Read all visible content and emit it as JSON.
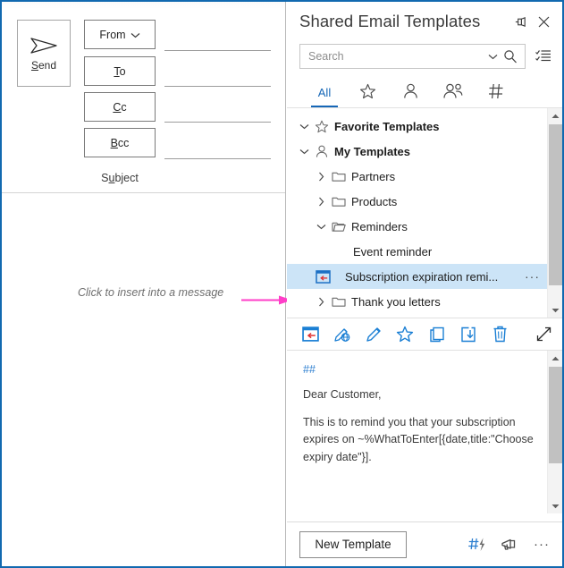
{
  "colors": {
    "window_border": "#1169b0",
    "accent_blue": "#1667b7",
    "icon_blue": "#1b7fd4",
    "selection_bg": "#cce4f7",
    "annotation_arrow": "#ff3ec8",
    "hash_blue": "#2d7fd0",
    "insert_icon_arrow": "#e03030"
  },
  "compose": {
    "send_button": {
      "label": "Send",
      "accel": "S",
      "icon": "send-arrow-icon"
    },
    "fields": [
      {
        "label": "From",
        "accel": "",
        "icon": "chevron-down-icon",
        "name": "from"
      },
      {
        "label": "To",
        "accel": "T",
        "icon": "",
        "name": "to"
      },
      {
        "label": "Cc",
        "accel": "C",
        "icon": "",
        "name": "cc"
      },
      {
        "label": "Bcc",
        "accel": "B",
        "icon": "",
        "name": "bcc"
      }
    ],
    "subject_label": "Subject",
    "subject_accel": "u",
    "annotation": "Click to insert into a message"
  },
  "panel": {
    "title": "Shared Email Templates",
    "header_icons": [
      {
        "name": "pin-icon",
        "glyph": "pin"
      },
      {
        "name": "close-icon",
        "glyph": "close"
      }
    ],
    "search": {
      "placeholder": "Search",
      "value": "",
      "dropdown_icon": "chevron-down-icon",
      "search_icon": "search-icon",
      "checklist_icon": "checklist-icon"
    },
    "tabs": [
      {
        "label": "All",
        "icon": "",
        "name": "tab-all",
        "active": true
      },
      {
        "label": "",
        "icon": "star-icon",
        "name": "tab-favorites",
        "active": false
      },
      {
        "label": "",
        "icon": "person-icon",
        "name": "tab-my-templates",
        "active": false
      },
      {
        "label": "",
        "icon": "people-icon",
        "name": "tab-team-templates",
        "active": false
      },
      {
        "label": "",
        "icon": "hash-icon",
        "name": "tab-tags",
        "active": false
      }
    ],
    "tree": [
      {
        "label": "Favorite Templates",
        "icon": "star-icon",
        "chev": "down",
        "depth": 1,
        "root": true,
        "selected": false
      },
      {
        "label": "My Templates",
        "icon": "person-icon",
        "chev": "down",
        "depth": 1,
        "root": true,
        "selected": false
      },
      {
        "label": "Partners",
        "icon": "folder-icon",
        "chev": "right",
        "depth": 2,
        "root": false,
        "selected": false
      },
      {
        "label": "Products",
        "icon": "folder-icon",
        "chev": "right",
        "depth": 2,
        "root": false,
        "selected": false
      },
      {
        "label": "Reminders",
        "icon": "folder-open-icon",
        "chev": "down",
        "depth": 2,
        "root": false,
        "selected": false
      },
      {
        "label": "Event reminder",
        "icon": "",
        "chev": "",
        "depth": 3,
        "root": false,
        "selected": false
      },
      {
        "label": "Subscription expiration remi...",
        "icon": "insert-template-icon",
        "chev": "",
        "depth": 3,
        "root": false,
        "selected": true,
        "ellipsis": "···"
      },
      {
        "label": "Thank you letters",
        "icon": "folder-icon",
        "chev": "right",
        "depth": 2,
        "root": false,
        "selected": false
      }
    ],
    "actions": [
      {
        "name": "insert-template-button",
        "icon": "insert-template-icon"
      },
      {
        "name": "edit-in-html-button",
        "icon": "pencil-globe-icon"
      },
      {
        "name": "edit-template-button",
        "icon": "pencil-icon"
      },
      {
        "name": "add-to-favorites-button",
        "icon": "star-icon"
      },
      {
        "name": "copy-button",
        "icon": "copy-icon"
      },
      {
        "name": "save-button",
        "icon": "save-down-icon"
      },
      {
        "name": "delete-button",
        "icon": "trash-icon"
      },
      {
        "name": "expand-button",
        "icon": "expand-diagonal-icon"
      }
    ],
    "preview": {
      "hash": "##",
      "paragraphs": [
        "Dear Customer,",
        "This is to remind you that your subscription expires on ~%WhatToEnter[{date,title:\"Choose expiry date\"}]."
      ]
    },
    "footer": {
      "new_template_label": "New Template",
      "icons": [
        {
          "name": "hash-lightning-icon",
          "glyph": "#"
        },
        {
          "name": "megaphone-icon",
          "glyph": "megaphone"
        },
        {
          "name": "more-options-icon",
          "glyph": "···"
        }
      ]
    }
  }
}
